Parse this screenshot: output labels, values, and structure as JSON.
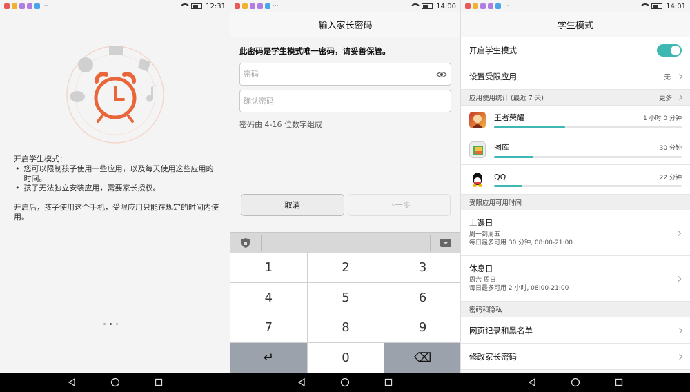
{
  "panels": [
    {
      "time": "12:31"
    },
    {
      "time": "14:00"
    },
    {
      "time": "14:01"
    }
  ],
  "intro": {
    "heading": "开启学生模式：",
    "bullets": [
      "您可以限制孩子使用一些应用，以及每天使用这些应用的时间。",
      "孩子无法独立安装应用，需要家长授权。"
    ],
    "footer": "开启后，孩子使用这个手机，受限应用只能在规定的时间内使用。"
  },
  "password": {
    "title": "输入家长密码",
    "notice": "此密码是学生模式唯一密码，请妥善保管。",
    "password_placeholder": "密码",
    "confirm_placeholder": "确认密码",
    "hint": "密码由 4-16 位数字组成",
    "cancel_label": "取消",
    "next_label": "下一步",
    "keys": [
      "1",
      "2",
      "3",
      "4",
      "5",
      "6",
      "7",
      "8",
      "9",
      "↵",
      "0",
      "⌫"
    ]
  },
  "student_mode": {
    "title": "学生模式",
    "enable_label": "开启学生模式",
    "enabled": true,
    "restricted_label": "设置受限应用",
    "restricted_value": "无",
    "usage_section": "应用使用统计 (最近 7 天)",
    "more_label": "更多",
    "apps": [
      {
        "name": "王者荣耀",
        "time": "1 小时 0 分钟",
        "fraction": 0.38
      },
      {
        "name": "图库",
        "time": "30 分钟",
        "fraction": 0.21
      },
      {
        "name": "QQ",
        "time": "22 分钟",
        "fraction": 0.15
      }
    ],
    "time_section": "受限应用可用时间",
    "schedules": [
      {
        "title": "上课日",
        "days": "周一到周五",
        "limit": "每日最多可用 30 分钟, 08:00-21:00"
      },
      {
        "title": "休息日",
        "days": "周六 周日",
        "limit": "每日最多可用 2 小时, 08:00-21:00"
      }
    ],
    "privacy_section": "密码和隐私",
    "history_label": "网页记录和黑名单",
    "change_pwd_label": "修改家长密码"
  },
  "colors": {
    "accent": "#3fb8b3",
    "alarm": "#e8663a"
  }
}
